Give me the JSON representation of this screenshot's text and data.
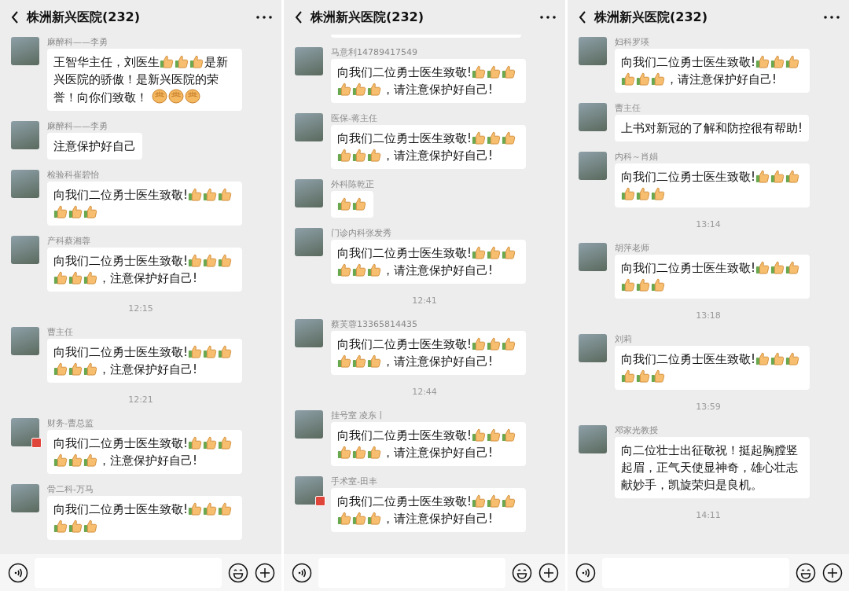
{
  "panels": [
    {
      "title": "株洲新兴医院(232)",
      "items": [
        {
          "kind": "message",
          "sender": "麻醉科——李勇",
          "badge": false,
          "parts": [
            {
              "kind": "text",
              "text": "王智华主任，刘医生"
            },
            {
              "kind": "thumbs-up"
            },
            {
              "kind": "thumbs-up"
            },
            {
              "kind": "thumbs-up"
            },
            {
              "kind": "text",
              "text": "是新"
            },
            {
              "kind": "text",
              "text": "兴医院的骄傲！是新兴医院的荣"
            },
            {
              "kind": "text",
              "text": "誉！向你们致敬！ "
            },
            {
              "kind": "fist"
            },
            {
              "kind": "fist"
            },
            {
              "kind": "fist"
            }
          ]
        },
        {
          "kind": "message",
          "sender": "麻醉科——李勇",
          "badge": false,
          "parts": [
            {
              "kind": "text",
              "text": "注意保护好自己"
            }
          ]
        },
        {
          "kind": "message",
          "sender": "检验科崔碧怡",
          "badge": false,
          "parts": [
            {
              "kind": "text",
              "text": "向我们二位勇士医生致敬!"
            },
            {
              "kind": "thumbs-up"
            },
            {
              "kind": "thumbs-up"
            },
            {
              "kind": "thumbs-up"
            },
            {
              "kind": "thumbs-up"
            },
            {
              "kind": "thumbs-up"
            },
            {
              "kind": "thumbs-up"
            }
          ]
        },
        {
          "kind": "message",
          "sender": "产科蔡湘蓉",
          "badge": false,
          "parts": [
            {
              "kind": "text",
              "text": "向我们二位勇士医生致敬!"
            },
            {
              "kind": "thumbs-up"
            },
            {
              "kind": "thumbs-up"
            },
            {
              "kind": "thumbs-up"
            },
            {
              "kind": "thumbs-up"
            },
            {
              "kind": "thumbs-up"
            },
            {
              "kind": "thumbs-up"
            },
            {
              "kind": "text",
              "text": "，注意保护好自己!"
            }
          ]
        },
        {
          "kind": "time",
          "text": "12:15"
        },
        {
          "kind": "message",
          "sender": "曹主任",
          "badge": false,
          "parts": [
            {
              "kind": "text",
              "text": "向我们二位勇士医生致敬!"
            },
            {
              "kind": "thumbs-up"
            },
            {
              "kind": "thumbs-up"
            },
            {
              "kind": "thumbs-up"
            },
            {
              "kind": "thumbs-up"
            },
            {
              "kind": "thumbs-up"
            },
            {
              "kind": "thumbs-up"
            },
            {
              "kind": "text",
              "text": "，注意保护好自己!"
            }
          ]
        },
        {
          "kind": "time",
          "text": "12:21"
        },
        {
          "kind": "message",
          "sender": "财务-曹总监",
          "badge": true,
          "parts": [
            {
              "kind": "text",
              "text": "向我们二位勇士医生致敬!"
            },
            {
              "kind": "thumbs-up"
            },
            {
              "kind": "thumbs-up"
            },
            {
              "kind": "thumbs-up"
            },
            {
              "kind": "thumbs-up"
            },
            {
              "kind": "thumbs-up"
            },
            {
              "kind": "thumbs-up"
            },
            {
              "kind": "text",
              "text": "，注意保护好自己!"
            }
          ]
        },
        {
          "kind": "message",
          "sender": "骨二科-万马",
          "badge": false,
          "parts": [
            {
              "kind": "text",
              "text": "向我们二位勇士医生致敬!"
            },
            {
              "kind": "thumbs-up"
            },
            {
              "kind": "thumbs-up"
            },
            {
              "kind": "thumbs-up"
            },
            {
              "kind": "thumbs-up"
            },
            {
              "kind": "thumbs-up"
            },
            {
              "kind": "thumbs-up"
            }
          ]
        }
      ]
    },
    {
      "title": "株洲新兴医院(232)",
      "items": [
        {
          "kind": "cut-off"
        },
        {
          "kind": "message",
          "sender": "马意利14789417549",
          "badge": false,
          "parts": [
            {
              "kind": "text",
              "text": "向我们二位勇士医生致敬!"
            },
            {
              "kind": "thumbs-up"
            },
            {
              "kind": "thumbs-up"
            },
            {
              "kind": "thumbs-up"
            },
            {
              "kind": "thumbs-up"
            },
            {
              "kind": "thumbs-up"
            },
            {
              "kind": "thumbs-up"
            },
            {
              "kind": "text",
              "text": "，请注意保护好自己!"
            }
          ]
        },
        {
          "kind": "message",
          "sender": "医保-蒋主任",
          "badge": false,
          "parts": [
            {
              "kind": "text",
              "text": "向我们二位勇士医生致敬!"
            },
            {
              "kind": "thumbs-up"
            },
            {
              "kind": "thumbs-up"
            },
            {
              "kind": "thumbs-up"
            },
            {
              "kind": "thumbs-up"
            },
            {
              "kind": "thumbs-up"
            },
            {
              "kind": "thumbs-up"
            },
            {
              "kind": "text",
              "text": "，请注意保护好自己!"
            }
          ]
        },
        {
          "kind": "message",
          "sender": "外科陈乾正",
          "badge": false,
          "parts": [
            {
              "kind": "thumbs-up"
            },
            {
              "kind": "thumbs-up"
            }
          ]
        },
        {
          "kind": "message",
          "sender": "门诊内科张发秀",
          "badge": false,
          "parts": [
            {
              "kind": "text",
              "text": "向我们二位勇士医生致敬!"
            },
            {
              "kind": "thumbs-up"
            },
            {
              "kind": "thumbs-up"
            },
            {
              "kind": "thumbs-up"
            },
            {
              "kind": "thumbs-up"
            },
            {
              "kind": "thumbs-up"
            },
            {
              "kind": "thumbs-up"
            },
            {
              "kind": "text",
              "text": "，请注意保护好自己!"
            }
          ]
        },
        {
          "kind": "time",
          "text": "12:41"
        },
        {
          "kind": "message",
          "sender": "蔡芙蓉13365814435",
          "badge": false,
          "parts": [
            {
              "kind": "text",
              "text": "向我们二位勇士医生致敬!"
            },
            {
              "kind": "thumbs-up"
            },
            {
              "kind": "thumbs-up"
            },
            {
              "kind": "thumbs-up"
            },
            {
              "kind": "thumbs-up"
            },
            {
              "kind": "thumbs-up"
            },
            {
              "kind": "thumbs-up"
            },
            {
              "kind": "text",
              "text": "，请注意保护好自己!"
            }
          ]
        },
        {
          "kind": "time",
          "text": "12:44"
        },
        {
          "kind": "message",
          "sender": "挂号室 凌东丨",
          "badge": false,
          "parts": [
            {
              "kind": "text",
              "text": "向我们二位勇士医生致敬!"
            },
            {
              "kind": "thumbs-up"
            },
            {
              "kind": "thumbs-up"
            },
            {
              "kind": "thumbs-up"
            },
            {
              "kind": "thumbs-up"
            },
            {
              "kind": "thumbs-up"
            },
            {
              "kind": "thumbs-up"
            },
            {
              "kind": "text",
              "text": "，请注意保护好自己!"
            }
          ]
        },
        {
          "kind": "message",
          "sender": "手术室-田丰",
          "badge": true,
          "parts": [
            {
              "kind": "text",
              "text": "向我们二位勇士医生致敬!"
            },
            {
              "kind": "thumbs-up"
            },
            {
              "kind": "thumbs-up"
            },
            {
              "kind": "thumbs-up"
            },
            {
              "kind": "thumbs-up"
            },
            {
              "kind": "thumbs-up"
            },
            {
              "kind": "thumbs-up"
            },
            {
              "kind": "text",
              "text": "，请注意保护好自己!"
            }
          ]
        }
      ]
    },
    {
      "title": "株洲新兴医院(232)",
      "items": [
        {
          "kind": "message",
          "sender": "妇科罗瑛",
          "badge": false,
          "parts": [
            {
              "kind": "text",
              "text": "向我们二位勇士医生致敬!"
            },
            {
              "kind": "thumbs-up"
            },
            {
              "kind": "thumbs-up"
            },
            {
              "kind": "thumbs-up"
            },
            {
              "kind": "thumbs-up"
            },
            {
              "kind": "thumbs-up"
            },
            {
              "kind": "thumbs-up"
            },
            {
              "kind": "text",
              "text": "，请注意保护好自己!"
            }
          ]
        },
        {
          "kind": "message",
          "sender": "曹主任",
          "badge": false,
          "parts": [
            {
              "kind": "text",
              "text": "上书对新冠的了解和防控很有帮助!"
            }
          ]
        },
        {
          "kind": "message",
          "sender": "内科～肖娟",
          "badge": false,
          "parts": [
            {
              "kind": "text",
              "text": "向我们二位勇士医生致敬!"
            },
            {
              "kind": "thumbs-up"
            },
            {
              "kind": "thumbs-up"
            },
            {
              "kind": "thumbs-up"
            },
            {
              "kind": "thumbs-up"
            },
            {
              "kind": "thumbs-up"
            },
            {
              "kind": "thumbs-up"
            }
          ]
        },
        {
          "kind": "time",
          "text": "13:14"
        },
        {
          "kind": "message",
          "sender": "胡萍老师",
          "badge": false,
          "parts": [
            {
              "kind": "text",
              "text": "向我们二位勇士医生致敬!"
            },
            {
              "kind": "thumbs-up"
            },
            {
              "kind": "thumbs-up"
            },
            {
              "kind": "thumbs-up"
            },
            {
              "kind": "thumbs-up"
            },
            {
              "kind": "thumbs-up"
            },
            {
              "kind": "thumbs-up"
            }
          ]
        },
        {
          "kind": "time",
          "text": "13:18"
        },
        {
          "kind": "message",
          "sender": "刘莉",
          "badge": false,
          "parts": [
            {
              "kind": "text",
              "text": "向我们二位勇士医生致敬!"
            },
            {
              "kind": "thumbs-up"
            },
            {
              "kind": "thumbs-up"
            },
            {
              "kind": "thumbs-up"
            },
            {
              "kind": "thumbs-up"
            },
            {
              "kind": "thumbs-up"
            },
            {
              "kind": "thumbs-up"
            }
          ]
        },
        {
          "kind": "time",
          "text": "13:59"
        },
        {
          "kind": "message",
          "sender": "邓家光教授",
          "badge": false,
          "parts": [
            {
              "kind": "text",
              "text": "向二位壮士出征敬祝！挺起胸膛竖起眉，正气天使显神奇，雄心壮志献妙手，凯旋荣归是良机。"
            }
          ]
        },
        {
          "kind": "time",
          "text": "14:11"
        }
      ]
    }
  ]
}
